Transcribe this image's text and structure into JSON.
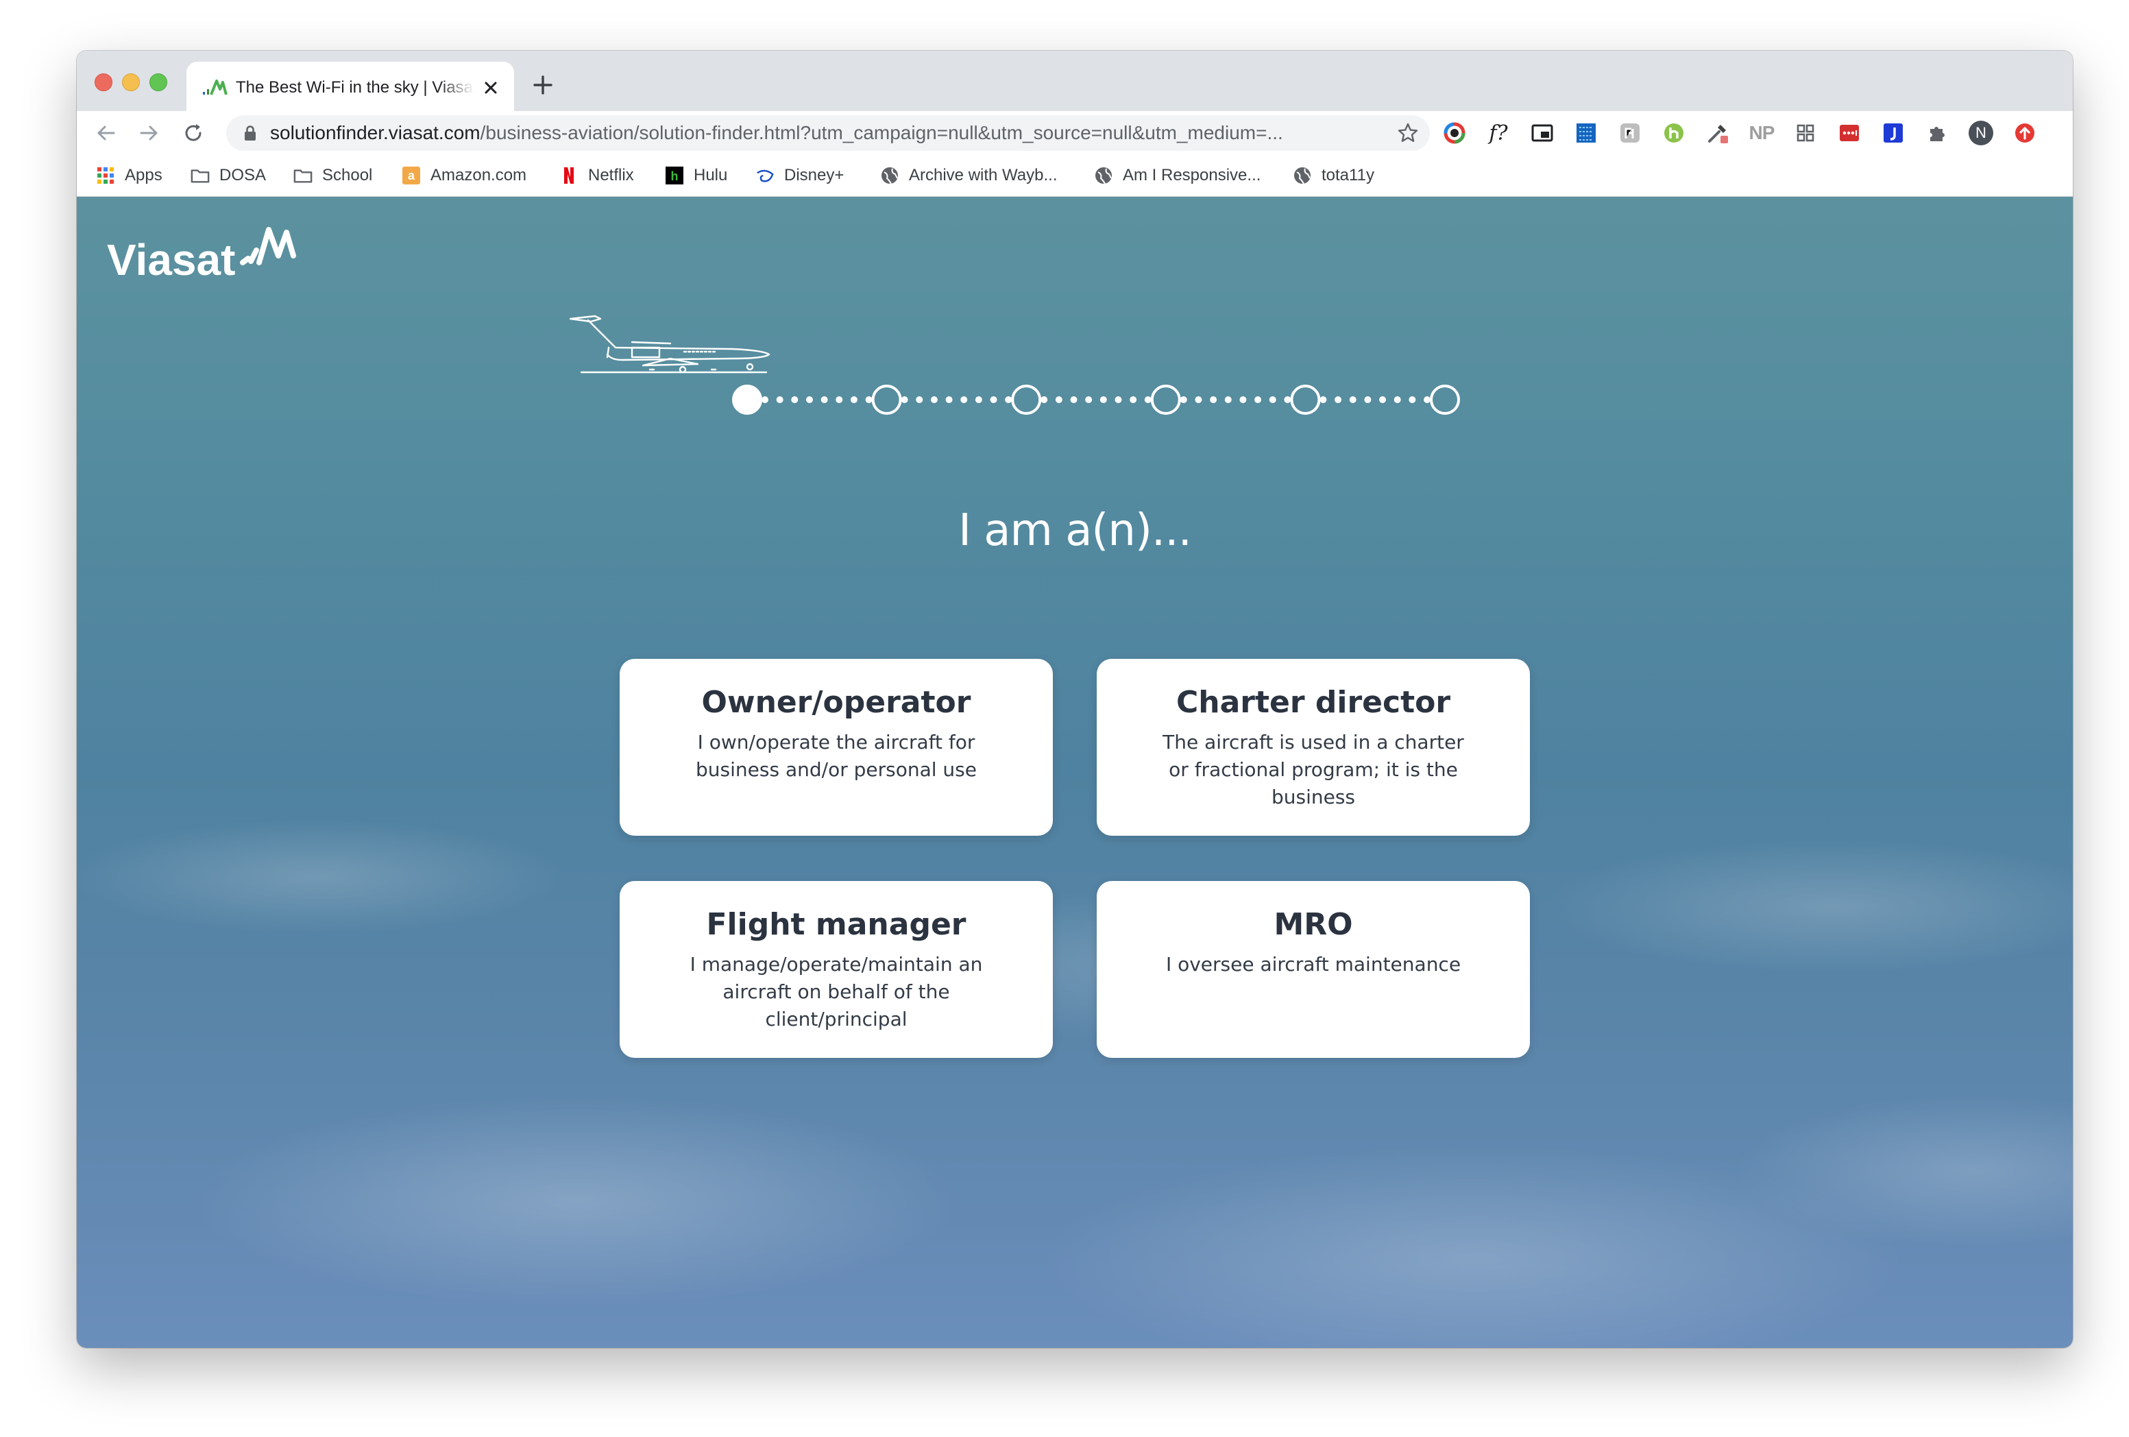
{
  "browser": {
    "tab_title": "The Best Wi-Fi in the sky | Viasat",
    "url_host": "solutionfinder.viasat.com",
    "url_path": "/business-aviation/solution-finder.html?utm_campaign=null&utm_source=null&utm_medium=...",
    "extensions": [
      {
        "name": "colorzilla-extension-icon"
      },
      {
        "name": "whatfont-extension-icon",
        "text": "f?"
      },
      {
        "name": "picture-in-picture-extension-icon"
      },
      {
        "name": "pixel-extension-icon"
      },
      {
        "name": "gray-extension-icon"
      },
      {
        "name": "honey-extension-icon"
      },
      {
        "name": "eyedropper-extension-icon"
      },
      {
        "name": "np-extension-icon",
        "text": "NP"
      },
      {
        "name": "grid-extension-icon"
      },
      {
        "name": "lastpass-extension-icon"
      },
      {
        "name": "jira-extension-icon"
      },
      {
        "name": "extensions-puzzle-icon"
      },
      {
        "name": "profile-avatar",
        "text": "N"
      },
      {
        "name": "update-icon"
      }
    ],
    "bookmarks": [
      {
        "label": "Apps"
      },
      {
        "label": "DOSA"
      },
      {
        "label": "School"
      },
      {
        "label": "Amazon.com"
      },
      {
        "label": "Netflix"
      },
      {
        "label": "Hulu"
      },
      {
        "label": "Disney+"
      },
      {
        "label": "Archive with Wayb..."
      },
      {
        "label": "Am I Responsive..."
      },
      {
        "label": "tota11y"
      }
    ]
  },
  "page": {
    "logo_text": "Viasat",
    "progress": {
      "total_steps": 6,
      "current_step": 1
    },
    "question": "I am a(n)...",
    "options": [
      {
        "title": "Owner/operator",
        "description": "I own/operate the aircraft for business and/or personal use"
      },
      {
        "title": "Charter director",
        "description": "The aircraft is used in a charter or fractional program; it is the business"
      },
      {
        "title": "Flight manager",
        "description": "I manage/operate/maintain an aircraft on behalf of the client/principal"
      },
      {
        "title": "MRO",
        "description": "I oversee aircraft maintenance"
      }
    ]
  }
}
